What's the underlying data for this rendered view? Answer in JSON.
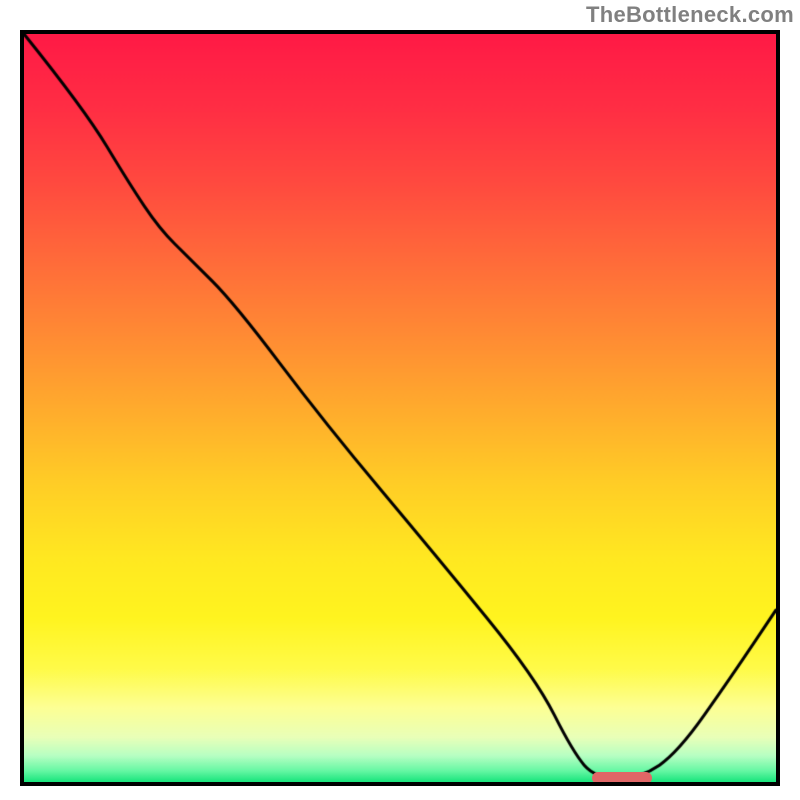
{
  "watermark": "TheBottleneck.com",
  "colors": {
    "gradient_stops": [
      {
        "pos": 0.0,
        "color": "#ff1a46"
      },
      {
        "pos": 0.1,
        "color": "#ff2e44"
      },
      {
        "pos": 0.2,
        "color": "#ff4a3f"
      },
      {
        "pos": 0.3,
        "color": "#ff6a3a"
      },
      {
        "pos": 0.4,
        "color": "#ff8a34"
      },
      {
        "pos": 0.5,
        "color": "#ffab2d"
      },
      {
        "pos": 0.6,
        "color": "#ffcd26"
      },
      {
        "pos": 0.7,
        "color": "#ffe821"
      },
      {
        "pos": 0.78,
        "color": "#fff41f"
      },
      {
        "pos": 0.85,
        "color": "#fffb4a"
      },
      {
        "pos": 0.9,
        "color": "#fdff94"
      },
      {
        "pos": 0.94,
        "color": "#e9ffb8"
      },
      {
        "pos": 0.965,
        "color": "#b7ffc3"
      },
      {
        "pos": 0.985,
        "color": "#66f7a4"
      },
      {
        "pos": 1.0,
        "color": "#17e57c"
      }
    ],
    "line": "#000000",
    "marker": "#e06666",
    "border": "#000000",
    "watermark": "#808080"
  },
  "chart_data": {
    "type": "line",
    "title": "",
    "xlabel": "",
    "ylabel": "",
    "xlim": [
      0,
      100
    ],
    "ylim": [
      0,
      100
    ],
    "series": [
      {
        "name": "curve",
        "x": [
          0,
          8,
          14,
          18,
          22,
          28,
          40,
          55,
          68,
          73,
          76,
          82,
          87,
          94,
          100
        ],
        "y": [
          100,
          90,
          80,
          74,
          70,
          64,
          48,
          30,
          14,
          4,
          0.5,
          0.5,
          4,
          14,
          23
        ]
      }
    ],
    "flat_segment": {
      "x1": 76,
      "x2": 82,
      "y": 0.5
    },
    "marker": {
      "x_center": 79.5,
      "width_x": 8,
      "y": 0.5
    }
  }
}
